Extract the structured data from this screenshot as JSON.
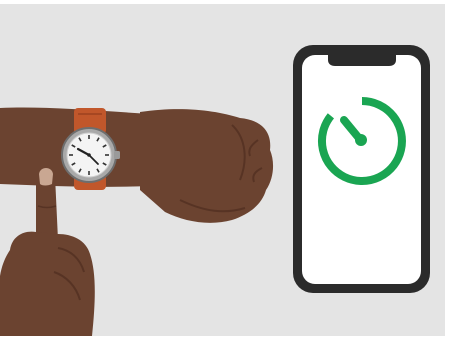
{
  "colors": {
    "background": "#e4e4e4",
    "phone_body": "#2b2b2b",
    "phone_screen": "#ffffff",
    "timer_icon": "#1aa552",
    "skin": "#6b4330",
    "skin_shadow": "#4a2a1c",
    "watch_strap": "#c1572b",
    "watch_case": "#b9b9b9"
  },
  "icons": {
    "phone_screen_icon": "timer-icon",
    "wrist_watch": "wristwatch-icon",
    "hand": "pointing-finger-icon"
  }
}
